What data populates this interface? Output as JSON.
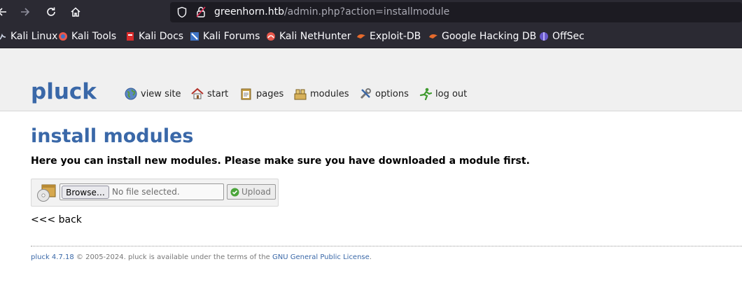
{
  "browser": {
    "url_host": "greenhorn.htb",
    "url_path": "/admin.php?action=installmodule",
    "bookmarks": [
      {
        "label": "Kali Linux",
        "icon": "kali-dragon-icon"
      },
      {
        "label": "Kali Tools",
        "icon": "kali-tools-icon"
      },
      {
        "label": "Kali Docs",
        "icon": "kali-docs-icon"
      },
      {
        "label": "Kali Forums",
        "icon": "kali-forums-icon"
      },
      {
        "label": "Kali NetHunter",
        "icon": "nethunter-icon"
      },
      {
        "label": "Exploit-DB",
        "icon": "exploit-db-icon"
      },
      {
        "label": "Google Hacking DB",
        "icon": "ghdb-icon"
      },
      {
        "label": "OffSec",
        "icon": "offsec-icon"
      }
    ]
  },
  "header": {
    "logo": "pluck",
    "menu": [
      {
        "label": "view site",
        "icon": "globe-icon"
      },
      {
        "label": "start",
        "icon": "home-icon"
      },
      {
        "label": "pages",
        "icon": "pages-icon"
      },
      {
        "label": "modules",
        "icon": "modules-icon"
      },
      {
        "label": "options",
        "icon": "options-icon"
      },
      {
        "label": "log out",
        "icon": "logout-icon"
      }
    ]
  },
  "main": {
    "title": "install modules",
    "intro": "Here you can install new modules. Please make sure you have downloaded a module first.",
    "browse_label": "Browse…",
    "file_status": "No file selected.",
    "upload_label": "Upload",
    "back_label": "<<< back"
  },
  "footer": {
    "version_link": "pluck 4.7.18",
    "text": " © 2005-2024. pluck is available under the terms of the ",
    "license_link": "GNU General Public License",
    "end": "."
  },
  "colors": {
    "brand_blue": "#3a68a8",
    "chrome_dark": "#2b2a33",
    "urlbar": "#1c1b22"
  }
}
